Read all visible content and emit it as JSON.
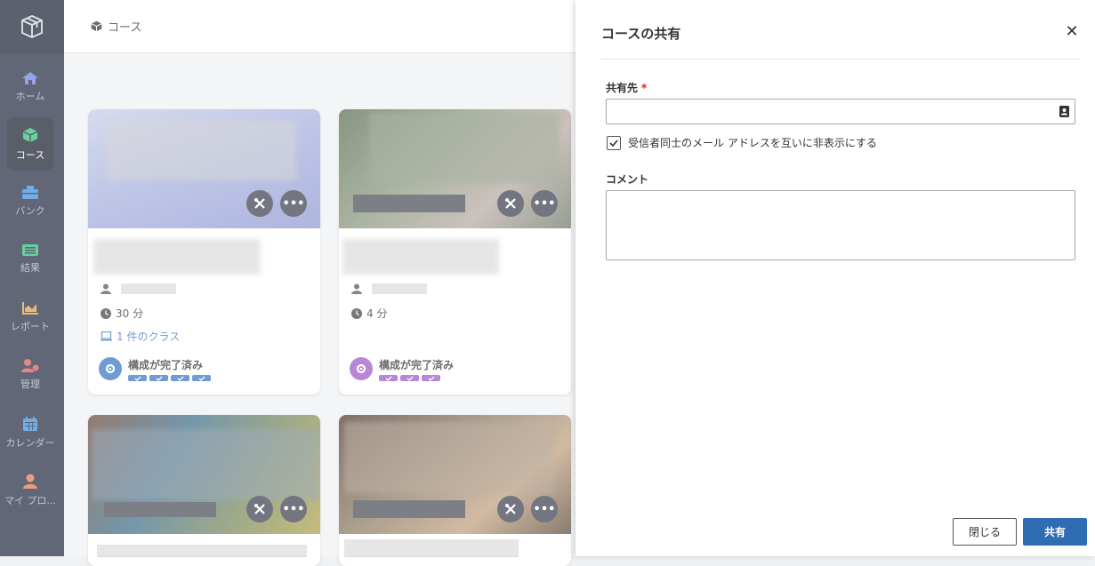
{
  "sidebar": {
    "items": [
      {
        "label": "ホーム",
        "icon": "home-icon",
        "color": "#6b7fe0"
      },
      {
        "label": "コース",
        "icon": "cube-icon",
        "color": "#2ec27e",
        "active": true
      },
      {
        "label": "バンク",
        "icon": "bank-icon",
        "color": "#3b8fe0"
      },
      {
        "label": "結果",
        "icon": "results-icon",
        "color": "#2ebd7a"
      },
      {
        "label": "レポート",
        "icon": "chart-icon",
        "color": "#e6a23c"
      },
      {
        "label": "管理",
        "icon": "admin-icon",
        "color": "#e15656"
      },
      {
        "label": "カレンダー",
        "icon": "calendar-icon",
        "color": "#3b8fe0"
      },
      {
        "label": "マイ プロ...",
        "icon": "user-icon",
        "color": "#e8774a"
      }
    ]
  },
  "header": {
    "breadcrumb": "コース"
  },
  "cards": [
    {
      "duration": "30 分",
      "classes": "1 件のクラス",
      "status": "構成が完了済み",
      "status_color": "#3a76c4"
    },
    {
      "duration": "4 分",
      "status": "構成が完了済み",
      "status_color": "#9c5bc7"
    }
  ],
  "panel": {
    "title": "コースの共有",
    "share_to_label": "共有先",
    "required_mark": "*",
    "share_to_value": "",
    "hide_emails_label": "受信者同士のメール アドレスを互いに非表示にする",
    "hide_emails_checked": true,
    "comment_label": "コメント",
    "comment_value": "",
    "close_button": "閉じる",
    "share_button": "共有"
  }
}
